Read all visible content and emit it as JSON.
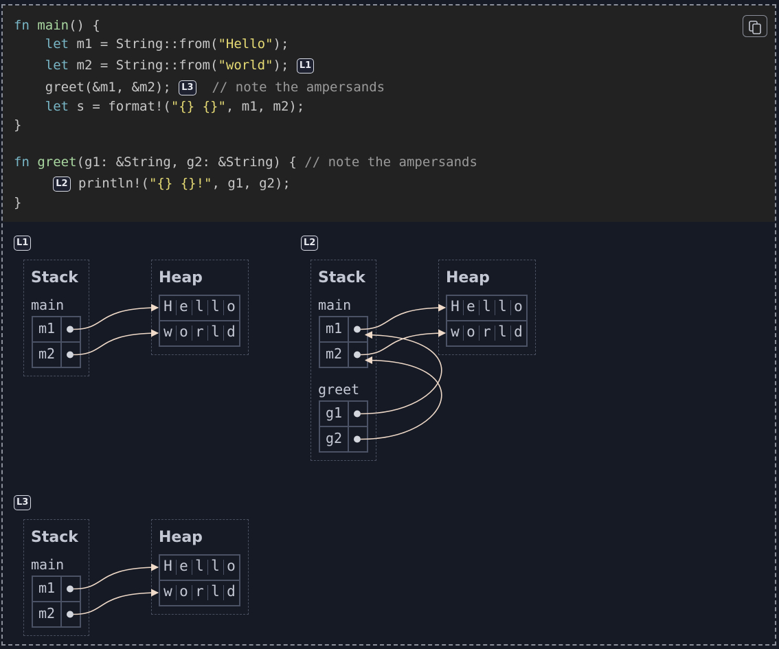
{
  "code": {
    "lines": [
      [
        {
          "t": "kw",
          "v": "fn "
        },
        {
          "t": "fnn",
          "v": "main"
        },
        {
          "t": "p",
          "v": "() {"
        }
      ],
      [
        {
          "t": "p",
          "v": "    "
        },
        {
          "t": "kw",
          "v": "let"
        },
        {
          "t": "p",
          "v": " m1 = String::from("
        },
        {
          "t": "str",
          "v": "\"Hello\""
        },
        {
          "t": "p",
          "v": ");"
        }
      ],
      [
        {
          "t": "p",
          "v": "    "
        },
        {
          "t": "kw",
          "v": "let"
        },
        {
          "t": "p",
          "v": " m2 = String::from("
        },
        {
          "t": "str",
          "v": "\"world\""
        },
        {
          "t": "p",
          "v": "); "
        },
        {
          "t": "badge",
          "v": "L1"
        }
      ],
      [
        {
          "t": "p",
          "v": "    greet(&m1, &m2); "
        },
        {
          "t": "badge",
          "v": "L3"
        },
        {
          "t": "p",
          "v": "  "
        },
        {
          "t": "cm",
          "v": "// note the ampersands"
        }
      ],
      [
        {
          "t": "p",
          "v": "    "
        },
        {
          "t": "kw",
          "v": "let"
        },
        {
          "t": "p",
          "v": " s = format!("
        },
        {
          "t": "str",
          "v": "\"{} {}\""
        },
        {
          "t": "p",
          "v": ", m1, m2);"
        }
      ],
      [
        {
          "t": "p",
          "v": "}"
        }
      ],
      [],
      [
        {
          "t": "kw",
          "v": "fn "
        },
        {
          "t": "fnn",
          "v": "greet"
        },
        {
          "t": "p",
          "v": "(g1: &String, g2: &String) { "
        },
        {
          "t": "cm",
          "v": "// note the ampersands"
        }
      ],
      [
        {
          "t": "p",
          "v": "     "
        },
        {
          "t": "badge",
          "v": "L2"
        },
        {
          "t": "p",
          "v": " println!("
        },
        {
          "t": "str",
          "v": "\"{} {}!\""
        },
        {
          "t": "p",
          "v": ", g1, g2);"
        }
      ],
      [
        {
          "t": "p",
          "v": "}"
        }
      ]
    ]
  },
  "diagrams": [
    {
      "label": "L1",
      "stack_title": "Stack",
      "heap_title": "Heap",
      "frames": [
        {
          "name": "main",
          "vars": [
            "m1",
            "m2"
          ]
        }
      ],
      "heap": [
        [
          "H",
          "e",
          "l",
          "l",
          "o"
        ],
        [
          "w",
          "o",
          "r",
          "l",
          "d"
        ]
      ]
    },
    {
      "label": "L2",
      "stack_title": "Stack",
      "heap_title": "Heap",
      "frames": [
        {
          "name": "main",
          "vars": [
            "m1",
            "m2"
          ]
        },
        {
          "name": "greet",
          "vars": [
            "g1",
            "g2"
          ]
        }
      ],
      "heap": [
        [
          "H",
          "e",
          "l",
          "l",
          "o"
        ],
        [
          "w",
          "o",
          "r",
          "l",
          "d"
        ]
      ]
    },
    {
      "label": "L3",
      "stack_title": "Stack",
      "heap_title": "Heap",
      "frames": [
        {
          "name": "main",
          "vars": [
            "m1",
            "m2"
          ]
        }
      ],
      "heap": [
        [
          "H",
          "e",
          "l",
          "l",
          "o"
        ],
        [
          "w",
          "o",
          "r",
          "l",
          "d"
        ]
      ]
    }
  ],
  "colors": {
    "arrow": "#efd9c8",
    "cell_border": "#4c5266",
    "background": "#161a25",
    "code_background": "#222222"
  },
  "icons": {
    "copy": "copy-icon"
  }
}
